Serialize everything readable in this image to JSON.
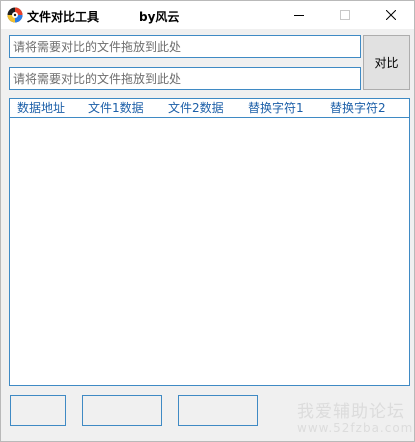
{
  "window": {
    "title": "文件对比工具",
    "author": "by风云",
    "icon": "app-disc-icon"
  },
  "controls": {
    "minimize_icon": "minimize-icon",
    "maximize_icon": "maximize-icon",
    "close_icon": "close-icon"
  },
  "inputs": {
    "file1": {
      "placeholder": "请将需要对比的文件拖放到此处",
      "value": ""
    },
    "file2": {
      "placeholder": "请将需要对比的文件拖放到此处",
      "value": ""
    }
  },
  "compare_button": {
    "label": "对比"
  },
  "list": {
    "columns": [
      "数据地址",
      "文件1数据",
      "文件2数据",
      "替换字符1",
      "替换字符2"
    ],
    "rows": []
  },
  "status": [
    "",
    "",
    ""
  ],
  "watermark": {
    "text": "我爱辅助论坛",
    "url": "www.52fzba.com"
  },
  "colors": {
    "accent_border": "#3f8ac4",
    "header_text": "#1c5fa8",
    "window_bg": "#f0f0f0"
  }
}
